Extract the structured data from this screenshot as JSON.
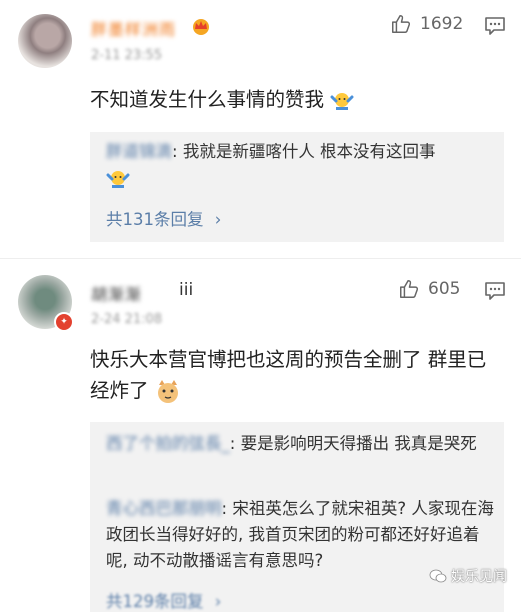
{
  "comments": [
    {
      "username": "胖墨样洲雨",
      "timestamp": "2-11 23:55",
      "like_count": "1692",
      "text": "不知道发生什么事情的赞我",
      "text_emoji": "shrug-emoji",
      "replies": [
        {
          "name": "胖道锦滴",
          "text": "我就是新疆喀什人 根本没有这回事",
          "emoji": "shrug-emoji"
        }
      ],
      "more_link": "共131条回复"
    },
    {
      "username": "胡渐渐",
      "username_suffix": "iii",
      "timestamp": "2-24 21:08",
      "like_count": "605",
      "text": "快乐大本营官博把也这周的预告全删了 群里已经炸了",
      "text_emoji": "cat-emoji",
      "replies": [
        {
          "name": "西了个拍的弦長_",
          "text": "要是影响明天得播出 我真是哭死"
        },
        {
          "name": "青心西巴那朋明",
          "text": "宋祖英怎么了就宋祖英? 人家现在海政团长当得好好的, 我首页宋团的粉可都还好好追着呢, 动不动散播谣言有意思吗?"
        }
      ],
      "more_link": "共129条回复"
    }
  ],
  "watermark": "娱乐见闻",
  "colors": {
    "link": "#5b7ea8",
    "vip_name": "#f07a1f",
    "reply_bg": "#f2f2f2"
  }
}
